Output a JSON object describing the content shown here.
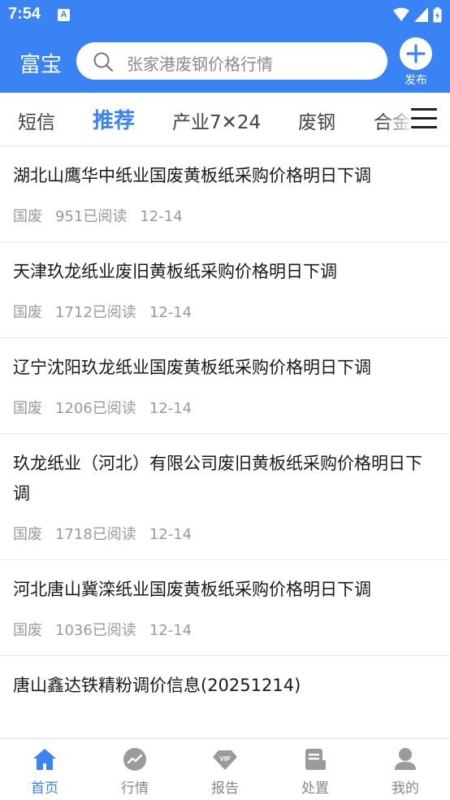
{
  "status_bar": {
    "time": "7:54",
    "notif_badge": "A"
  },
  "app_bar": {
    "brand": "富宝",
    "search_placeholder": "张家港废钢价格行情",
    "publish_label": "发布"
  },
  "tabs": [
    {
      "label": "短信",
      "active": false
    },
    {
      "label": "推荐",
      "active": true
    },
    {
      "label": "产业7✕24",
      "active": false
    },
    {
      "label": "废钢",
      "active": false
    },
    {
      "label": "合金",
      "active": false
    }
  ],
  "feed": [
    {
      "title": "湖北山鹰华中纸业国废黄板纸采购价格明日下调",
      "category": "国废",
      "reads": "951已阅读",
      "date": "12-14"
    },
    {
      "title": "天津玖龙纸业废旧黄板纸采购价格明日下调",
      "category": "国废",
      "reads": "1712已阅读",
      "date": "12-14"
    },
    {
      "title": "辽宁沈阳玖龙纸业国废黄板纸采购价格明日下调",
      "category": "国废",
      "reads": "1206已阅读",
      "date": "12-14"
    },
    {
      "title": "玖龙纸业（河北）有限公司废旧黄板纸采购价格明日下调",
      "category": "国废",
      "reads": "1718已阅读",
      "date": "12-14"
    },
    {
      "title": "河北唐山冀滦纸业国废黄板纸采购价格明日下调",
      "category": "国废",
      "reads": "1036已阅读",
      "date": "12-14"
    },
    {
      "title": "唐山鑫达铁精粉调价信息(20251214)",
      "category": "",
      "reads": "",
      "date": ""
    }
  ],
  "bottom_nav": [
    {
      "label": "首页",
      "icon": "home-icon",
      "active": true
    },
    {
      "label": "行情",
      "icon": "trend-icon",
      "active": false
    },
    {
      "label": "报告",
      "icon": "vip-diamond-icon",
      "active": false
    },
    {
      "label": "处置",
      "icon": "document-icon",
      "active": false
    },
    {
      "label": "我的",
      "icon": "user-icon",
      "active": false
    }
  ],
  "colors": {
    "brand_blue": "#3a83f5",
    "meta_gray": "#9a9a9a"
  }
}
